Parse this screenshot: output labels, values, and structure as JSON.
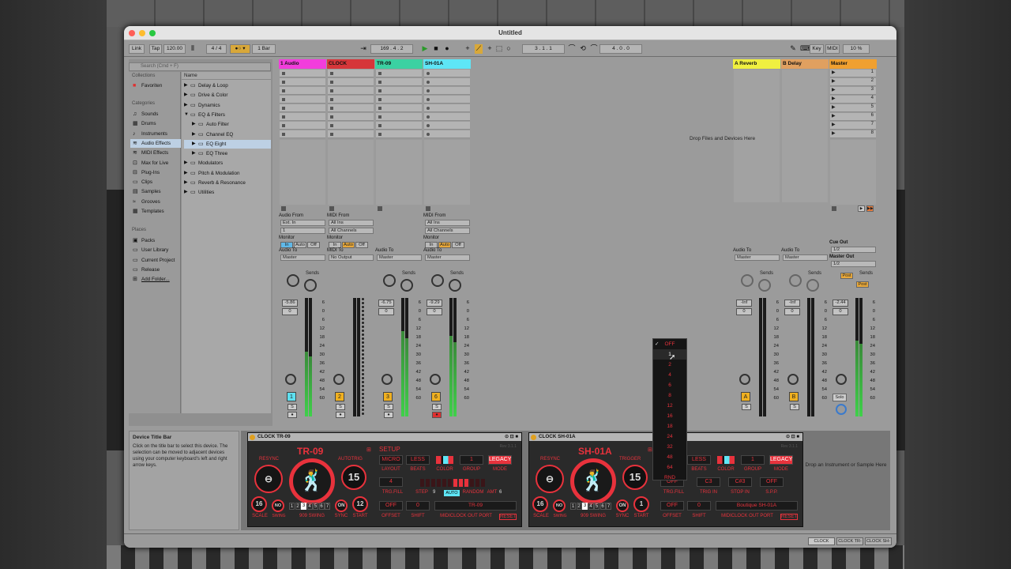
{
  "window": {
    "title": "Untitled"
  },
  "control_bar": {
    "link": "Link",
    "tap": "Tap",
    "tempo": "120.00",
    "signature": "4 / 4",
    "quantize": "1 Bar",
    "position": "169 .  4 .  2",
    "loop_start": "3 .  1 .  1",
    "loop_length": "4 .  0 .  0",
    "key": "Key",
    "midi": "MIDI",
    "cpu": "10 %"
  },
  "browser": {
    "search_placeholder": "Search (Cmd + F)",
    "collections_header": "Collections",
    "favorites": "Favoriten",
    "categories_header": "Categories",
    "categories": [
      "Sounds",
      "Drums",
      "Instruments",
      "Audio Effects",
      "MIDI Effects",
      "Max for Live",
      "Plug-Ins",
      "Clips",
      "Samples",
      "Grooves",
      "Templates"
    ],
    "places_header": "Places",
    "places": [
      "Packs",
      "User Library",
      "Current Project",
      "Release",
      "Add Folder..."
    ],
    "name_header": "Name",
    "items": [
      {
        "label": "Delay & Loop",
        "indent": 0
      },
      {
        "label": "Drive & Color",
        "indent": 0
      },
      {
        "label": "Dynamics",
        "indent": 0
      },
      {
        "label": "EQ & Filters",
        "indent": 0,
        "open": true
      },
      {
        "label": "Auto Filter",
        "indent": 1
      },
      {
        "label": "Channel EQ",
        "indent": 1
      },
      {
        "label": "EQ Eight",
        "indent": 1,
        "selected": true
      },
      {
        "label": "EQ Three",
        "indent": 1
      },
      {
        "label": "Modulators",
        "indent": 0
      },
      {
        "label": "Pitch & Modulation",
        "indent": 0
      },
      {
        "label": "Reverb & Resonance",
        "indent": 0
      },
      {
        "label": "Utilities",
        "indent": 0
      }
    ]
  },
  "info": {
    "title": "Device Title Bar",
    "text": "Click on the title bar to select this device. The selection can be moved to adjacent devices using your computer keyboard's left and right arrow keys."
  },
  "tracks": [
    {
      "name": "1 Audio",
      "color": "#f23ddc",
      "in_label": "Audio From",
      "in1": "Ext. In",
      "in2": "1",
      "monitor": "Monitor",
      "mon": [
        "In",
        "Auto",
        "Off"
      ],
      "out_label": "Audio To",
      "out": "Master",
      "sends": "Sends",
      "vol": "-5.86",
      "pan": "0",
      "num": "1",
      "numcolor": "#5ee0f0",
      "level": 0.55
    },
    {
      "name": "CLOCK",
      "color": "#d6363a",
      "in_label": "MIDI From",
      "in1": "All Ins",
      "in2": "All Channels",
      "monitor": "Monitor",
      "mon": [
        "In",
        "Auto",
        "Off"
      ],
      "out_label": "MIDI To",
      "out": "No Output",
      "sends": "",
      "vol": "",
      "pan": "",
      "num": "2",
      "numcolor": "#f0b020",
      "level": 0
    },
    {
      "name": "TR-09",
      "color": "#3bd1a2",
      "in_label": "",
      "in1": "",
      "in2": "",
      "monitor": "",
      "mon": [],
      "out_label": "Audio To",
      "out": "Master",
      "sends": "Sends",
      "vol": "-6.75",
      "pan": "0",
      "num": "3",
      "numcolor": "#f0b020",
      "level": 0.72
    },
    {
      "name": "SH-01A",
      "color": "#5ee6f6",
      "in_label": "MIDI From",
      "in1": "All Ins",
      "in2": "All Channels",
      "monitor": "Monitor",
      "mon": [
        "In",
        "Auto",
        "Off"
      ],
      "out_label": "Audio To",
      "out": "Master",
      "sends": "Sends",
      "vol": "-9.29",
      "pan": "0",
      "num": "6",
      "numcolor": "#f0b020",
      "level": 0.68
    }
  ],
  "returns": [
    {
      "name": "A Reverb",
      "color": "#f0f040",
      "out_label": "Audio To",
      "out": "Master",
      "sends": "Sends",
      "vol": "-Inf",
      "pan": "0",
      "num": "A"
    },
    {
      "name": "B Delay",
      "color": "#e0a060",
      "out_label": "Audio To",
      "out": "Master",
      "sends": "Sends",
      "vol": "-Inf",
      "pan": "0",
      "num": "B"
    }
  ],
  "master": {
    "name": "Master",
    "color": "#f0a030",
    "cue_label": "Cue Out",
    "cue": "1/2",
    "out_label": "Master Out",
    "out": "1/2",
    "sends": "Sends",
    "post1": "Post",
    "post2": "Post",
    "vol": "-2.44",
    "pan": "0",
    "solo": "Solo",
    "scenes": [
      "1",
      "2",
      "3",
      "4",
      "5",
      "6",
      "7",
      "8"
    ]
  },
  "scale_marks": [
    "6",
    "0",
    "6",
    "12",
    "18",
    "24",
    "30",
    "36",
    "42",
    "48",
    "54",
    "60"
  ],
  "drop_files": "Drop Files and Devices Here",
  "devices": [
    {
      "title": "CLOCK TR-09",
      "model": "TR-09",
      "resync": "RESYNC",
      "autotrig": "AUTOTRIG",
      "autotrig_val": "15",
      "scale": "16",
      "scale_label": "SCALE",
      "swing_val": "NO",
      "swing_label": "SWING",
      "swing909": "909 SWING",
      "swing_steps": [
        "1",
        "2",
        "3",
        "4",
        "5",
        "6",
        "7"
      ],
      "sync": "ON",
      "sync_label": "SYNC",
      "start": "12",
      "start_label": "START",
      "setup": "SETUP",
      "micro": "MICRO",
      "less": "LESS",
      "layout": "LAYOUT",
      "beats": "BEATS",
      "color": "COLOR",
      "group_val": "1",
      "group": "GROUP",
      "mode_val": "LEGACY",
      "mode": "MODE",
      "trg_val": "4",
      "trgfill": "TRG.FILL",
      "step": "STEP",
      "step_val": "9",
      "auto": "AUTO",
      "random": "RANDOM",
      "amt": "AMT",
      "amt_val": "6",
      "offset_val": "OFF",
      "offset": "OFFSET",
      "shift_val": "0",
      "shift": "SHIFT",
      "port_val": "TR-09",
      "port": "MIDICLOCK OUT PORT",
      "reset": "RESET",
      "version": "Rev 3.1.1"
    },
    {
      "title": "CLOCK SH-01A",
      "model": "SH-01A",
      "resync": "RESYNC",
      "autotrig": "TRIGGER",
      "autotrig_val": "15",
      "scale": "16",
      "scale_label": "SCALE",
      "swing_val": "NO",
      "swing_label": "SWING",
      "swing909": "909 SWING",
      "swing_steps": [
        "1",
        "2",
        "3",
        "4",
        "5",
        "6",
        "7"
      ],
      "sync": "ON",
      "sync_label": "SYNC",
      "start": "1",
      "start_label": "START",
      "setup": "",
      "micro": "",
      "less": "LESS",
      "layout": "",
      "beats": "BEATS",
      "color": "COLOR",
      "group_val": "1",
      "group": "GROUP",
      "mode_val": "LEGACY",
      "mode": "MODE",
      "trg_val": "OFF",
      "trgfill": "TRG.FILL",
      "trigin_val": "C3",
      "trigin": "TRIG IN",
      "stopin_val": "C#3",
      "stopin": "STOP IN",
      "spp_val": "OFF",
      "spp": "S.P.P.",
      "offset_val": "OFF",
      "offset": "OFFSET",
      "shift_val": "0",
      "shift": "SHIFT",
      "port_val": "Boutique SH-01A",
      "port": "MIDICLOCK OUT PORT",
      "reset": "RESET",
      "version": "Rev 3.1.1"
    }
  ],
  "drop_instrument": "Drop an Instrument or Sample Here",
  "popup": {
    "checked": "OFF",
    "items": [
      "OFF",
      "1",
      "2",
      "4",
      "6",
      "8",
      "12",
      "16",
      "18",
      "24",
      "32",
      "48",
      "64",
      "RND"
    ]
  },
  "statusbar": {
    "tabs": [
      "CLOCK",
      "CLOCK TR-",
      "CLOCK SH-"
    ]
  },
  "colors": {
    "accent_red": "#e8323c",
    "selection": "#bdd0e4"
  }
}
